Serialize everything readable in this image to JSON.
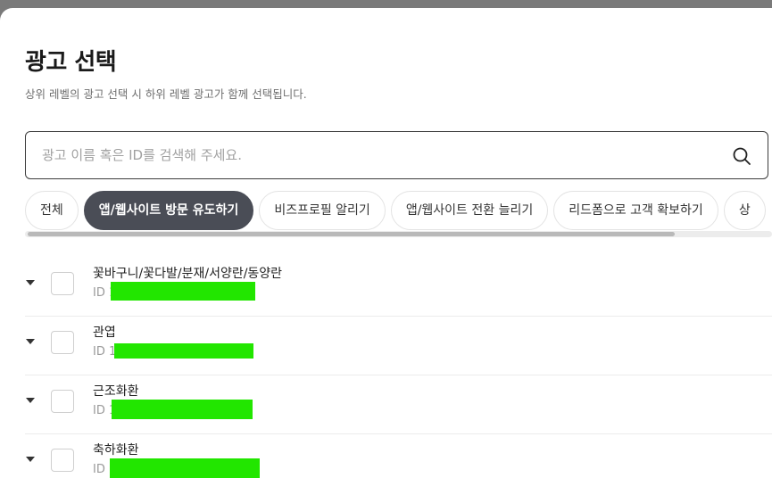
{
  "modal": {
    "title": "광고 선택",
    "subtitle": "상위 레벨의 광고 선택 시 하위 레벨 광고가 함께 선택됩니다."
  },
  "search": {
    "placeholder": "광고 이름 혹은 ID를 검색해 주세요.",
    "value": "",
    "icon": "search-icon"
  },
  "tabs": [
    {
      "label": "전체",
      "active": false
    },
    {
      "label": "앱/웹사이트 방문 유도하기",
      "active": true
    },
    {
      "label": "비즈프로필 알리기",
      "active": false
    },
    {
      "label": "앱/웹사이트 전환 늘리기",
      "active": false
    },
    {
      "label": "리드폼으로 고객 확보하기",
      "active": false
    },
    {
      "label": "상",
      "active": false
    }
  ],
  "list": [
    {
      "name": "꽃바구니/꽃다발/분재/서양란/동양란",
      "id_prefix": "ID 1"
    },
    {
      "name": "관엽",
      "id_prefix": "ID 1"
    },
    {
      "name": "근조화환",
      "id_prefix": "ID 1"
    },
    {
      "name": "축하화환",
      "id_prefix": "ID "
    }
  ],
  "colors": {
    "active_tab": "#4a4d56",
    "redaction": "#22e600",
    "border": "#3d3d3d"
  }
}
